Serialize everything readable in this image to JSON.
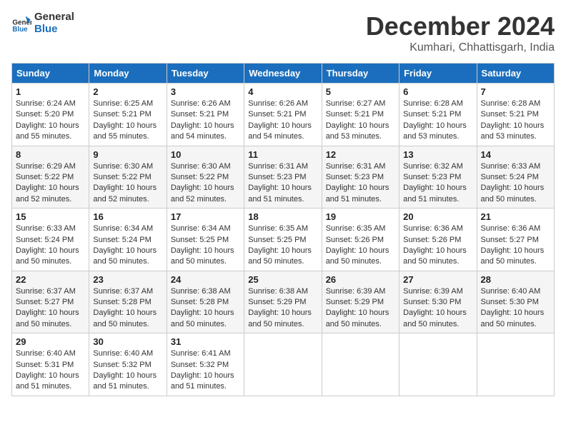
{
  "logo": {
    "line1": "General",
    "line2": "Blue"
  },
  "title": "December 2024",
  "location": "Kumhari, Chhattisgarh, India",
  "days_of_week": [
    "Sunday",
    "Monday",
    "Tuesday",
    "Wednesday",
    "Thursday",
    "Friday",
    "Saturday"
  ],
  "weeks": [
    [
      {
        "day": "1",
        "sunrise": "6:24 AM",
        "sunset": "5:20 PM",
        "daylight": "10 hours and 55 minutes."
      },
      {
        "day": "2",
        "sunrise": "6:25 AM",
        "sunset": "5:21 PM",
        "daylight": "10 hours and 55 minutes."
      },
      {
        "day": "3",
        "sunrise": "6:26 AM",
        "sunset": "5:21 PM",
        "daylight": "10 hours and 54 minutes."
      },
      {
        "day": "4",
        "sunrise": "6:26 AM",
        "sunset": "5:21 PM",
        "daylight": "10 hours and 54 minutes."
      },
      {
        "day": "5",
        "sunrise": "6:27 AM",
        "sunset": "5:21 PM",
        "daylight": "10 hours and 53 minutes."
      },
      {
        "day": "6",
        "sunrise": "6:28 AM",
        "sunset": "5:21 PM",
        "daylight": "10 hours and 53 minutes."
      },
      {
        "day": "7",
        "sunrise": "6:28 AM",
        "sunset": "5:21 PM",
        "daylight": "10 hours and 53 minutes."
      }
    ],
    [
      {
        "day": "8",
        "sunrise": "6:29 AM",
        "sunset": "5:22 PM",
        "daylight": "10 hours and 52 minutes."
      },
      {
        "day": "9",
        "sunrise": "6:30 AM",
        "sunset": "5:22 PM",
        "daylight": "10 hours and 52 minutes."
      },
      {
        "day": "10",
        "sunrise": "6:30 AM",
        "sunset": "5:22 PM",
        "daylight": "10 hours and 52 minutes."
      },
      {
        "day": "11",
        "sunrise": "6:31 AM",
        "sunset": "5:23 PM",
        "daylight": "10 hours and 51 minutes."
      },
      {
        "day": "12",
        "sunrise": "6:31 AM",
        "sunset": "5:23 PM",
        "daylight": "10 hours and 51 minutes."
      },
      {
        "day": "13",
        "sunrise": "6:32 AM",
        "sunset": "5:23 PM",
        "daylight": "10 hours and 51 minutes."
      },
      {
        "day": "14",
        "sunrise": "6:33 AM",
        "sunset": "5:24 PM",
        "daylight": "10 hours and 50 minutes."
      }
    ],
    [
      {
        "day": "15",
        "sunrise": "6:33 AM",
        "sunset": "5:24 PM",
        "daylight": "10 hours and 50 minutes."
      },
      {
        "day": "16",
        "sunrise": "6:34 AM",
        "sunset": "5:24 PM",
        "daylight": "10 hours and 50 minutes."
      },
      {
        "day": "17",
        "sunrise": "6:34 AM",
        "sunset": "5:25 PM",
        "daylight": "10 hours and 50 minutes."
      },
      {
        "day": "18",
        "sunrise": "6:35 AM",
        "sunset": "5:25 PM",
        "daylight": "10 hours and 50 minutes."
      },
      {
        "day": "19",
        "sunrise": "6:35 AM",
        "sunset": "5:26 PM",
        "daylight": "10 hours and 50 minutes."
      },
      {
        "day": "20",
        "sunrise": "6:36 AM",
        "sunset": "5:26 PM",
        "daylight": "10 hours and 50 minutes."
      },
      {
        "day": "21",
        "sunrise": "6:36 AM",
        "sunset": "5:27 PM",
        "daylight": "10 hours and 50 minutes."
      }
    ],
    [
      {
        "day": "22",
        "sunrise": "6:37 AM",
        "sunset": "5:27 PM",
        "daylight": "10 hours and 50 minutes."
      },
      {
        "day": "23",
        "sunrise": "6:37 AM",
        "sunset": "5:28 PM",
        "daylight": "10 hours and 50 minutes."
      },
      {
        "day": "24",
        "sunrise": "6:38 AM",
        "sunset": "5:28 PM",
        "daylight": "10 hours and 50 minutes."
      },
      {
        "day": "25",
        "sunrise": "6:38 AM",
        "sunset": "5:29 PM",
        "daylight": "10 hours and 50 minutes."
      },
      {
        "day": "26",
        "sunrise": "6:39 AM",
        "sunset": "5:29 PM",
        "daylight": "10 hours and 50 minutes."
      },
      {
        "day": "27",
        "sunrise": "6:39 AM",
        "sunset": "5:30 PM",
        "daylight": "10 hours and 50 minutes."
      },
      {
        "day": "28",
        "sunrise": "6:40 AM",
        "sunset": "5:30 PM",
        "daylight": "10 hours and 50 minutes."
      }
    ],
    [
      {
        "day": "29",
        "sunrise": "6:40 AM",
        "sunset": "5:31 PM",
        "daylight": "10 hours and 51 minutes."
      },
      {
        "day": "30",
        "sunrise": "6:40 AM",
        "sunset": "5:32 PM",
        "daylight": "10 hours and 51 minutes."
      },
      {
        "day": "31",
        "sunrise": "6:41 AM",
        "sunset": "5:32 PM",
        "daylight": "10 hours and 51 minutes."
      },
      null,
      null,
      null,
      null
    ]
  ]
}
